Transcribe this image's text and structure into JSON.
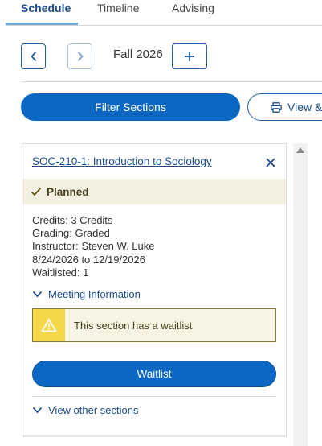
{
  "tabs": [
    {
      "label": "Schedule",
      "active": true
    },
    {
      "label": "Timeline",
      "active": false
    },
    {
      "label": "Advising",
      "active": false
    }
  ],
  "term_nav": {
    "term_label": "Fall 2026",
    "prev_icon": "chevron-left-icon",
    "next_icon": "chevron-right-icon",
    "add_icon": "plus-icon"
  },
  "actions": {
    "filter_label": "Filter Sections",
    "view_label": "View &",
    "view_icon": "printer-icon"
  },
  "course_card": {
    "title": "SOC-210-1: Introduction to Sociology",
    "status": "Planned",
    "details": {
      "credits": "Credits: 3 Credits",
      "grading": "Grading: Graded",
      "instructor": "Instructor: Steven W. Luke",
      "dates": "8/24/2026 to 12/19/2026",
      "waitlisted": "Waitlisted:  1"
    },
    "meeting_label": "Meeting Information",
    "warning_text": "This section has a waitlist",
    "waitlist_button": "Waitlist",
    "other_sections_label": "View other sections"
  },
  "colors": {
    "primary": "#0b67c2",
    "link": "#1a4c8b",
    "status_bg": "#f3efe1",
    "warning_icon_bg": "#f5d74a",
    "warning_bg": "#f8f4e4"
  }
}
